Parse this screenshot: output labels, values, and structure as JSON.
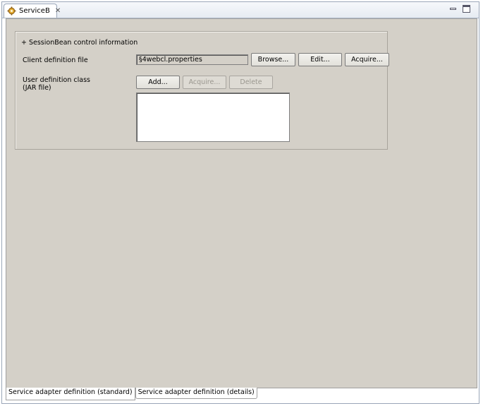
{
  "editor_tab": {
    "title": "ServiceB",
    "icon": "gear-component-icon"
  },
  "window_controls": {
    "minimize_icon": "minimize-icon",
    "maximize_icon": "maximize-icon"
  },
  "group": {
    "title": "+ SessionBean control information",
    "client_definition": {
      "label": "Client definition file",
      "value": "§4webcl.properties",
      "buttons": {
        "browse": "Browse...",
        "edit": "Edit...",
        "acquire": "Acquire..."
      }
    },
    "user_definition": {
      "label_line1": "User definition class",
      "label_line2": "(JAR file)",
      "buttons": {
        "add": "Add...",
        "acquire": "Acquire...",
        "delete": "Delete"
      },
      "items": []
    }
  },
  "bottom_tabs": [
    {
      "label": "Service adapter definition (standard)",
      "active": true
    },
    {
      "label": "Service adapter definition (details)",
      "active": false
    }
  ]
}
